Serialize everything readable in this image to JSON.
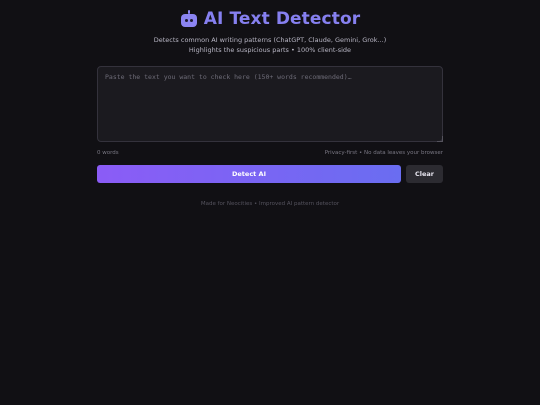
{
  "header": {
    "icon": "robot-icon",
    "title": "AI Text Detector",
    "subtitle_line1": "Detects common AI writing patterns (ChatGPT, Claude, Gemini, Grok...)",
    "subtitle_line2": "Highlights the suspicious parts • 100% client-side"
  },
  "input": {
    "value": "",
    "placeholder": "Paste the text you want to check here (150+ words recommended)…"
  },
  "meta": {
    "word_count": "0 words",
    "privacy": "Privacy-first • No data leaves your browser"
  },
  "actions": {
    "detect_label": "Detect AI",
    "clear_label": "Clear"
  },
  "footer": {
    "text": "Made for Neocities • Improved AI pattern detector"
  },
  "colors": {
    "background": "#111014",
    "accent": "#8680f0",
    "button_gradient_start": "#8b5cf6",
    "button_gradient_end": "#6a6df1"
  }
}
